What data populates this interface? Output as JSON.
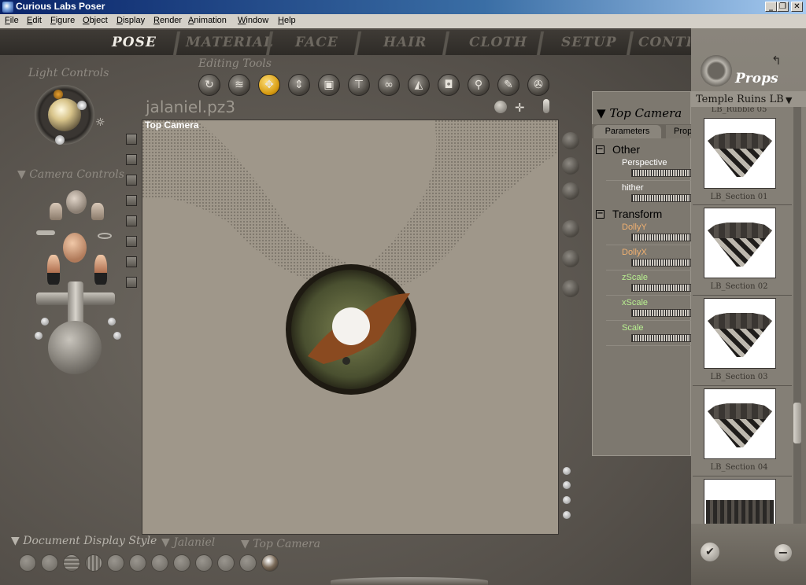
{
  "window": {
    "title": "Curious Labs Poser",
    "minimize_glyph": "_",
    "maximize_glyph": "❐",
    "close_glyph": "✕"
  },
  "menu": {
    "items": [
      {
        "hot": "F",
        "rest": "ile"
      },
      {
        "hot": "E",
        "rest": "dit"
      },
      {
        "hot": "F",
        "rest": "igure"
      },
      {
        "hot": "O",
        "rest": "bject"
      },
      {
        "hot": "D",
        "rest": "isplay"
      },
      {
        "hot": "R",
        "rest": "ender"
      },
      {
        "hot": "A",
        "rest": "nimation"
      },
      {
        "hot": "W",
        "rest": "indow"
      },
      {
        "hot": "H",
        "rest": "elp"
      }
    ]
  },
  "tabs": [
    "POSE",
    "MATERIAL",
    "FACE",
    "HAIR",
    "CLOTH",
    "SETUP",
    "CONTE"
  ],
  "active_tab": "POSE",
  "light_controls": {
    "label": "Light Controls"
  },
  "camera_controls": {
    "label": "Camera Controls"
  },
  "editing_tools": {
    "label": "Editing Tools",
    "icons": [
      "rotate-icon",
      "twist-icon",
      "translate-icon",
      "translate-in-out-icon",
      "scale-icon",
      "taper-icon",
      "chain-break-icon",
      "color-icon",
      "grouping-icon",
      "view-magnifier-icon",
      "morphing-tool-icon",
      "direct-manipulation-icon"
    ],
    "selected": "translate-icon"
  },
  "document": {
    "title": "jalaniel.pz3",
    "camera": "Top Camera"
  },
  "parameters": {
    "title": "Top Camera",
    "tabs": [
      "Parameters",
      "Prop"
    ],
    "groups": [
      {
        "name": "Other",
        "params": [
          {
            "label": "Perspective",
            "color": "#ffffff"
          },
          {
            "label": "hither",
            "color": "#ffffff"
          }
        ]
      },
      {
        "name": "Transform",
        "params": [
          {
            "label": "DollyY",
            "color": "#f0b070"
          },
          {
            "label": "DollyX",
            "color": "#f0b070"
          },
          {
            "label": "zScale",
            "color": "#b8f090"
          },
          {
            "label": "xScale",
            "color": "#b8f090"
          },
          {
            "label": "Scale",
            "color": "#b8f090"
          }
        ]
      }
    ]
  },
  "props_library": {
    "title": "Props",
    "category": "Temple Ruins LB",
    "items": [
      "LB_Rubble 05",
      "LB_Section 01",
      "LB_Section 02",
      "LB_Section 03",
      "LB_Section 04"
    ],
    "apply_glyph": "✔",
    "remove_glyph": "−"
  },
  "bottom": {
    "display_style_label": "Document Display Style",
    "figure_menu": "Jalaniel",
    "camera_menu": "Top Camera"
  },
  "colors": {
    "active_tool": "#d69a10",
    "accent_text": "#f0ede6"
  }
}
